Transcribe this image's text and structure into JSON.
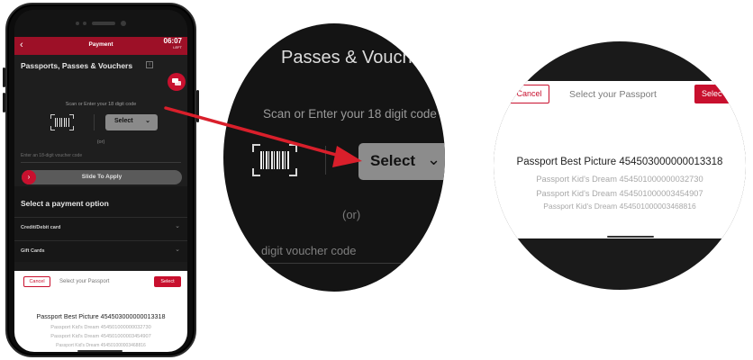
{
  "phone": {
    "appbar": {
      "back_icon": "chevron-left-icon",
      "title": "Payment",
      "timer": "06:07",
      "timer_sub": "LEFT"
    },
    "section_heading": "Passports, Passes & Vouchers",
    "info_icon": "info-icon",
    "chat_icon": "chat-bubble-icon",
    "scan_text": "Scan or Enter your 18 digit code",
    "barcode_icon": "barcode-scan-icon",
    "select_label": "Select",
    "or_text": "(or)",
    "voucher_placeholder": "Enter an 18-digit voucher code",
    "slider_label": "Slide To Apply",
    "payment_title": "Select a payment option",
    "payment_options": [
      {
        "label": "Credit/Debit card"
      },
      {
        "label": "Gift Cards"
      }
    ],
    "sheet": {
      "cancel": "Cancel",
      "title": "Select your Passport",
      "select": "Select",
      "options": [
        "Passport Best Picture 454503000000013318",
        "Passport Kid's Dream 454501000000032730",
        "Passport Kid's Dream 454501000003454907",
        "Passport Kid's Dream 454501000003468816"
      ]
    }
  },
  "zoom1": {
    "heading": "Passes & Vouche",
    "scan_text": "Scan or Enter your 18 digit code",
    "select_label": "Select",
    "or_text": "(or)",
    "voucher_placeholder": "digit voucher code"
  },
  "zoom2": {
    "cancel": "Cancel",
    "title": "Select your Passport",
    "select": "Selec",
    "options": [
      "Passport Best Picture 454503000000013318",
      "Passport Kid's Dream 454501000000032730",
      "Passport Kid's Dream 454501000003454907",
      "Passport Kid's Dream 454501000003468816"
    ]
  },
  "colors": {
    "brand_red": "#c8102e",
    "appbar_red": "#9d1027",
    "dark_bg": "#1e1e1e",
    "select_grey": "#8a8a8a"
  }
}
